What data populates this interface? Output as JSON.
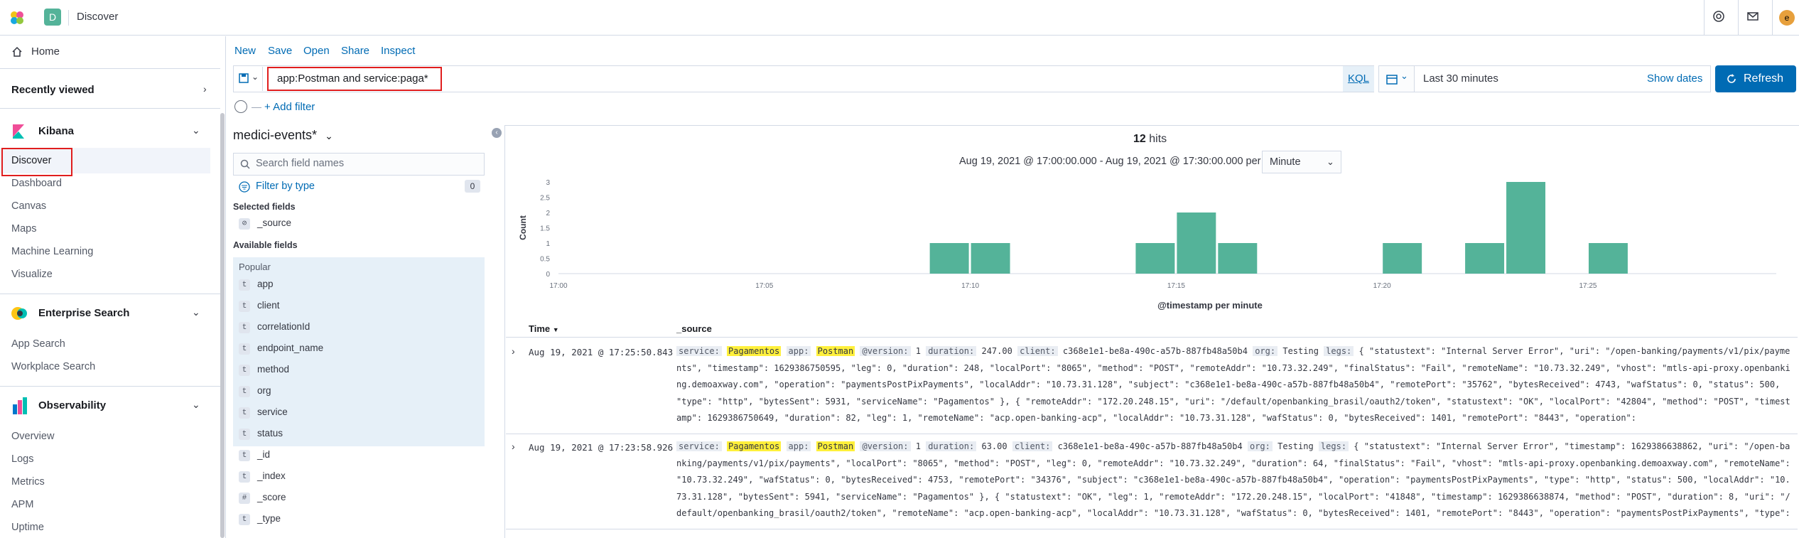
{
  "header": {
    "title": "Discover",
    "space_initial": "D",
    "user_initial": "e"
  },
  "nav": {
    "home": "Home",
    "recently_viewed": "Recently viewed",
    "kibana": {
      "title": "Kibana",
      "items": [
        "Discover",
        "Dashboard",
        "Canvas",
        "Maps",
        "Machine Learning",
        "Visualize"
      ]
    },
    "enterprise": {
      "title": "Enterprise Search",
      "items": [
        "App Search",
        "Workplace Search"
      ]
    },
    "observability": {
      "title": "Observability",
      "items": [
        "Overview",
        "Logs",
        "Metrics",
        "APM",
        "Uptime"
      ]
    }
  },
  "toolbar": {
    "menu": [
      "New",
      "Save",
      "Open",
      "Share",
      "Inspect"
    ],
    "query": "app:Postman and service:paga*",
    "kql": "KQL",
    "date_range": "Last 30 minutes",
    "show_dates": "Show dates",
    "refresh": "Refresh",
    "add_filter": "+ Add filter"
  },
  "sidebar": {
    "index_pattern": "medici-events*",
    "search_placeholder": "Search field names",
    "filter_by_type": "Filter by type",
    "filter_count": "0",
    "selected_fields_label": "Selected fields",
    "selected_fields": [
      {
        "type": "⊘",
        "name": "_source"
      }
    ],
    "available_fields_label": "Available fields",
    "popular_label": "Popular",
    "popular_fields": [
      {
        "type": "t",
        "name": "app"
      },
      {
        "type": "t",
        "name": "client"
      },
      {
        "type": "t",
        "name": "correlationId"
      },
      {
        "type": "t",
        "name": "endpoint_name"
      },
      {
        "type": "t",
        "name": "method"
      },
      {
        "type": "t",
        "name": "org"
      },
      {
        "type": "t",
        "name": "service"
      },
      {
        "type": "t",
        "name": "status"
      }
    ],
    "other_fields": [
      {
        "type": "t",
        "name": "_id"
      },
      {
        "type": "t",
        "name": "_index"
      },
      {
        "type": "#",
        "name": "_score"
      },
      {
        "type": "t",
        "name": "_type"
      }
    ]
  },
  "results": {
    "hits_count": "12",
    "hits_label": "hits",
    "range_text": "Aug 19, 2021 @ 17:00:00.000 - Aug 19, 2021 @ 17:30:00.000 per",
    "interval": "Minute",
    "columns": [
      "Time",
      "_source"
    ],
    "rows": [
      {
        "time": "Aug 19, 2021 @ 17:25:50.843",
        "service": "Pagamentos",
        "app": "Postman",
        "version": "1",
        "duration": "247.00",
        "client": "c368e1e1-be8a-490c-a57b-887fb48a50b4",
        "org": "Testing",
        "legs": "{ \"statustext\": \"Internal Server Error\", \"uri\": \"/open-banking/payments/v1/pix/payments\", \"timestamp\": 1629386750595, \"leg\": 0, \"duration\": 248, \"localPort\": \"8065\", \"method\": \"POST\", \"remoteAddr\": \"10.73.32.249\", \"finalStatus\": \"Fail\", \"remoteName\": \"10.73.32.249\", \"vhost\": \"mtls-api-proxy.openbanking.demoaxway.com\", \"operation\": \"paymentsPostPixPayments\", \"localAddr\": \"10.73.31.128\", \"subject\": \"c368e1e1-be8a-490c-a57b-887fb48a50b4\", \"remotePort\": \"35762\", \"bytesReceived\": 4743, \"wafStatus\": 0, \"status\": 500, \"type\": \"http\", \"bytesSent\": 5931, \"serviceName\": \"Pagamentos\" }, { \"remoteAddr\": \"172.20.248.15\", \"uri\": \"/default/openbanking_brasil/oauth2/token\", \"statustext\": \"OK\", \"localPort\": \"42804\", \"method\": \"POST\", \"timestamp\": 1629386750649, \"duration\": 82, \"leg\": 1, \"remoteName\": \"acp.open-banking-acp\", \"localAddr\": \"10.73.31.128\", \"wafStatus\": 0, \"bytesReceived\": 1401, \"remotePort\": \"8443\", \"operation\":"
      },
      {
        "time": "Aug 19, 2021 @ 17:23:58.926",
        "service": "Pagamentos",
        "app": "Postman",
        "version": "1",
        "duration": "63.00",
        "client": "c368e1e1-be8a-490c-a57b-887fb48a50b4",
        "org": "Testing",
        "legs": "{ \"statustext\": \"Internal Server Error\", \"timestamp\": 1629386638862, \"uri\": \"/open-banking/payments/v1/pix/payments\", \"localPort\": \"8065\", \"method\": \"POST\", \"leg\": 0, \"remoteAddr\": \"10.73.32.249\", \"duration\": 64, \"finalStatus\": \"Fail\", \"vhost\": \"mtls-api-proxy.openbanking.demoaxway.com\", \"remoteName\": \"10.73.32.249\", \"wafStatus\": 0, \"bytesReceived\": 4753, \"remotePort\": \"34376\", \"subject\": \"c368e1e1-be8a-490c-a57b-887fb48a50b4\", \"operation\": \"paymentsPostPixPayments\", \"type\": \"http\", \"status\": 500, \"localAddr\": \"10.73.31.128\", \"bytesSent\": 5941, \"serviceName\": \"Pagamentos\" }, { \"statustext\": \"OK\", \"leg\": 1, \"remoteAddr\": \"172.20.248.15\", \"localPort\": \"41848\", \"timestamp\": 1629386638874, \"method\": \"POST\", \"duration\": 8, \"uri\": \"/default/openbanking_brasil/oauth2/token\", \"remoteName\": \"acp.open-banking-acp\", \"localAddr\": \"10.73.31.128\", \"wafStatus\": 0, \"bytesReceived\": 1401, \"remotePort\": \"8443\", \"operation\": \"paymentsPostPixPayments\", \"type\":"
      }
    ],
    "field_labels": {
      "service": "service:",
      "app": "app:",
      "version": "@version:",
      "duration": "duration:",
      "client": "client:",
      "org": "org:",
      "legs": "legs:"
    }
  },
  "chart_data": {
    "type": "bar",
    "ylabel": "Count",
    "xlabel": "@timestamp per minute",
    "ylim": [
      0,
      3
    ],
    "yticks": [
      "0",
      "0.5",
      "1",
      "1.5",
      "2",
      "2.5",
      "3"
    ],
    "xticks": [
      "17:00",
      "17:05",
      "17:10",
      "17:15",
      "17:20",
      "17:25"
    ],
    "x": [
      "17:09",
      "17:10",
      "17:14",
      "17:15",
      "17:16",
      "17:20",
      "17:22",
      "17:23",
      "17:25"
    ],
    "values": [
      1,
      1,
      1,
      2,
      1,
      1,
      1,
      3,
      1
    ],
    "bar_color": "#54b399"
  },
  "colors": {
    "accent": "#006bb4",
    "highlight": "#fff03b",
    "annotation_box": "#e01e1e"
  }
}
